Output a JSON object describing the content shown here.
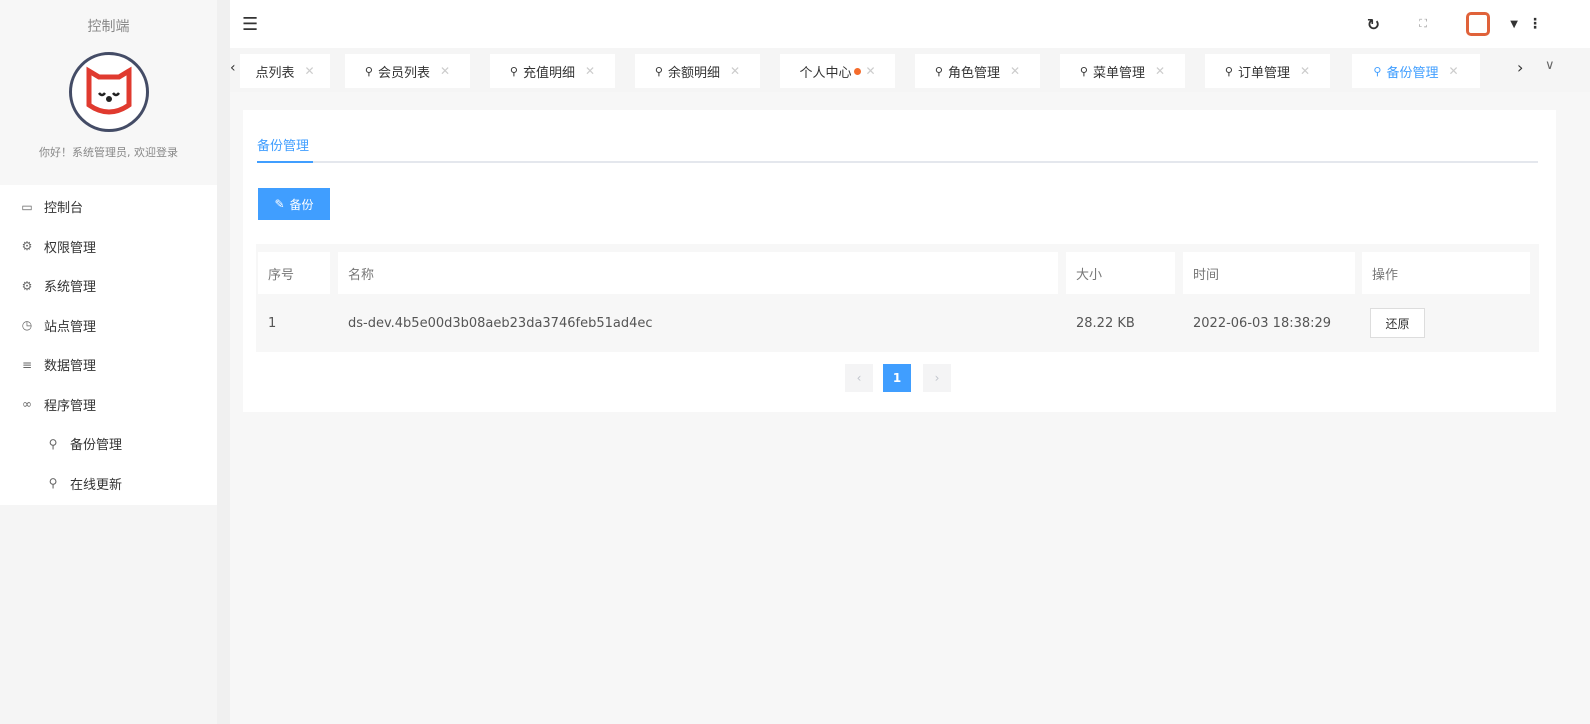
{
  "sidebar": {
    "title": "控制端",
    "greeting": "你好！系统管理员, 欢迎登录",
    "items": [
      {
        "label": "控制台",
        "icon": "monitor-icon"
      },
      {
        "label": "权限管理",
        "icon": "gear-icon"
      },
      {
        "label": "系统管理",
        "icon": "gear-icon"
      },
      {
        "label": "站点管理",
        "icon": "clock-icon"
      },
      {
        "label": "数据管理",
        "icon": "list-icon"
      },
      {
        "label": "程序管理",
        "icon": "link-icon"
      }
    ],
    "subitems": [
      {
        "label": "备份管理"
      },
      {
        "label": "在线更新"
      }
    ]
  },
  "tabs": [
    {
      "label": "点列表"
    },
    {
      "label": "会员列表"
    },
    {
      "label": "充值明细"
    },
    {
      "label": "余额明细"
    },
    {
      "label": "个人中心"
    },
    {
      "label": "角色管理"
    },
    {
      "label": "菜单管理"
    },
    {
      "label": "订单管理"
    },
    {
      "label": "备份管理",
      "active": true
    }
  ],
  "content": {
    "tab": "备份管理",
    "backup_button": "备份",
    "columns": [
      "序号",
      "名称",
      "大小",
      "时间",
      "操作"
    ],
    "rows": [
      {
        "index": "1",
        "name": "ds-dev.4b5e00d3b08aeb23da3746feb51ad4ec",
        "size": "28.22 KB",
        "time": "2022-06-03 18:38:29",
        "action": "还原"
      }
    ],
    "pagination": {
      "current": "1"
    }
  },
  "colors": {
    "accent": "#409eff"
  }
}
